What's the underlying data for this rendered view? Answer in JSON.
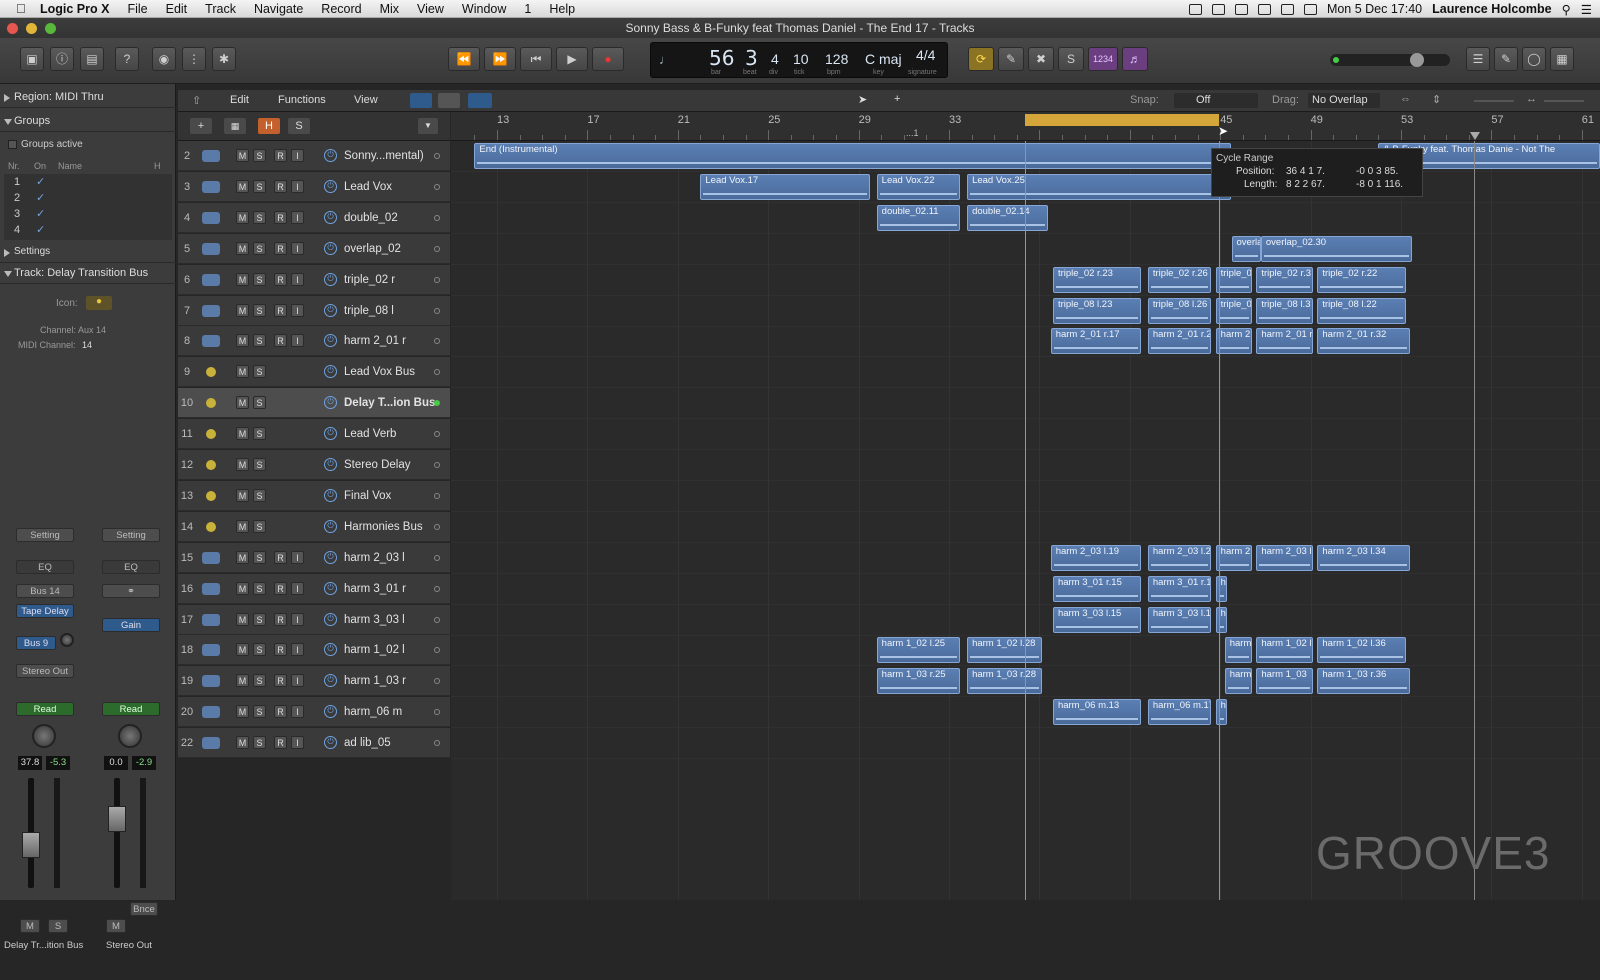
{
  "menubar": {
    "app": "Logic Pro X",
    "items": [
      "File",
      "Edit",
      "Track",
      "Navigate",
      "Record",
      "Mix",
      "View",
      "Window",
      "1",
      "Help"
    ],
    "datetime": "Mon 5 Dec  17:40",
    "user": "Laurence Holcombe"
  },
  "window": {
    "title": "Sonny Bass & B-Funky feat Thomas Daniel - The End 17 - Tracks"
  },
  "lcd": {
    "bar": "56",
    "beat": "3",
    "div": "4",
    "tick": "10",
    "bpm": "128",
    "key": "C maj",
    "sig": "4/4",
    "cap_bar": "bar",
    "cap_beat": "beat",
    "cap_div": "div",
    "cap_tick": "tick",
    "cap_bpm": "bpm",
    "cap_key": "key",
    "cap_sig": "signature"
  },
  "toolbar": {
    "count_in": "1234"
  },
  "subbar": {
    "edit": "Edit",
    "functions": "Functions",
    "view": "View",
    "snap_label": "Snap:",
    "snap_value": "Off",
    "drag_label": "Drag:",
    "drag_value": "No Overlap"
  },
  "inspector": {
    "region": "Region: MIDI Thru",
    "groups": "Groups",
    "groups_active": "Groups active",
    "cols": {
      "nr": "Nr.",
      "on": "On",
      "name": "Name",
      "h": "H"
    },
    "group_rows": [
      "1",
      "2",
      "3",
      "4"
    ],
    "settings": "Settings",
    "track": "Track:  Delay Transition Bus",
    "icon_label": "Icon:",
    "channel": "Channel: Aux 14",
    "midi_channel_label": "MIDI Channel:",
    "midi_channel": "14",
    "strip1": {
      "setting": "Setting",
      "eq": "EQ",
      "bus": "Bus 14",
      "insert": "Tape Delay",
      "send": "Bus 9",
      "output": "Stereo Out",
      "auto": "Read",
      "pan": "37.8",
      "vol": "-5.3",
      "m": "M",
      "s": "S",
      "name": "Delay Tr...ition Bus"
    },
    "strip2": {
      "setting": "Setting",
      "eq": "EQ",
      "insert": "Gain",
      "auto": "Read",
      "pan": "0.0",
      "vol": "-2.9",
      "bnce": "Bnce",
      "m": "M",
      "name": "Stereo Out"
    }
  },
  "ruler": {
    "bars": [
      "13",
      "17",
      "21",
      "25",
      "29",
      "33",
      "37",
      "41",
      "45",
      "49",
      "53",
      "57",
      "61"
    ],
    "marker": "...1"
  },
  "tracks": [
    {
      "num": "2",
      "name": "Sonny...mental)",
      "type": "audio",
      "rs": true
    },
    {
      "num": "3",
      "name": "Lead Vox",
      "type": "audio",
      "rs": true
    },
    {
      "num": "4",
      "name": "double_02",
      "type": "audio",
      "rs": true
    },
    {
      "num": "5",
      "name": "overlap_02",
      "type": "audio",
      "rs": true
    },
    {
      "num": "6",
      "name": "triple_02 r",
      "type": "audio",
      "rs": true
    },
    {
      "num": "7",
      "name": "triple_08 l",
      "type": "audio",
      "rs": true
    },
    {
      "num": "8",
      "name": "harm 2_01 r",
      "type": "audio",
      "rs": true
    },
    {
      "num": "9",
      "name": "Lead Vox Bus",
      "type": "aux",
      "rs": false
    },
    {
      "num": "10",
      "name": "Delay T...ion Bus",
      "type": "aux",
      "rs": false,
      "selected": true
    },
    {
      "num": "11",
      "name": "Lead Verb",
      "type": "aux",
      "rs": false
    },
    {
      "num": "12",
      "name": "Stereo Delay",
      "type": "aux",
      "rs": false
    },
    {
      "num": "13",
      "name": "Final Vox",
      "type": "aux",
      "rs": false
    },
    {
      "num": "14",
      "name": "Harmonies Bus",
      "type": "aux",
      "rs": false
    },
    {
      "num": "15",
      "name": "harm 2_03 l",
      "type": "audio",
      "rs": true
    },
    {
      "num": "16",
      "name": "harm 3_01 r",
      "type": "audio",
      "rs": true
    },
    {
      "num": "17",
      "name": "harm 3_03 l",
      "type": "audio",
      "rs": true
    },
    {
      "num": "18",
      "name": "harm 1_02 l",
      "type": "audio",
      "rs": true
    },
    {
      "num": "19",
      "name": "harm 1_03 r",
      "type": "audio",
      "rs": true
    },
    {
      "num": "20",
      "name": "harm_06 m",
      "type": "audio",
      "rs": true
    },
    {
      "num": "22",
      "name": "ad lib_05",
      "type": "audio",
      "rs": true
    }
  ],
  "track_buttons": {
    "m": "M",
    "s": "S",
    "r": "R",
    "i": "I"
  },
  "regions": [
    {
      "row": 0,
      "bar_start": 12,
      "bar_end": 45.5,
      "label": "End (Instrumental)"
    },
    {
      "row": 0,
      "bar_start": 52,
      "bar_end": 63,
      "label": "& B-Funky feat. Thomas Danie - Not The"
    },
    {
      "row": 1,
      "bar_start": 22,
      "bar_end": 29.5,
      "label": "Lead Vox.17"
    },
    {
      "row": 1,
      "bar_start": 29.8,
      "bar_end": 33.5,
      "label": "Lead Vox.22"
    },
    {
      "row": 1,
      "bar_start": 33.8,
      "bar_end": 45.5,
      "label": "Lead Vox.25"
    },
    {
      "row": 2,
      "bar_start": 29.8,
      "bar_end": 33.5,
      "label": "double_02.11"
    },
    {
      "row": 2,
      "bar_start": 33.8,
      "bar_end": 37.4,
      "label": "double_02.14"
    },
    {
      "row": 3,
      "bar_start": 45.5,
      "bar_end": 46.8,
      "label": "overla"
    },
    {
      "row": 3,
      "bar_start": 46.8,
      "bar_end": 53.5,
      "label": "overlap_02.30"
    },
    {
      "row": 4,
      "bar_start": 37.6,
      "bar_end": 41.5,
      "label": "triple_02 r.23"
    },
    {
      "row": 4,
      "bar_start": 41.8,
      "bar_end": 44.6,
      "label": "triple_02 r.26"
    },
    {
      "row": 4,
      "bar_start": 44.8,
      "bar_end": 46.4,
      "label": "triple_0"
    },
    {
      "row": 4,
      "bar_start": 46.6,
      "bar_end": 49.1,
      "label": "triple_02 r.3"
    },
    {
      "row": 4,
      "bar_start": 49.3,
      "bar_end": 53.2,
      "label": "triple_02 r.22"
    },
    {
      "row": 5,
      "bar_start": 37.6,
      "bar_end": 41.5,
      "label": "triple_08 l.23"
    },
    {
      "row": 5,
      "bar_start": 41.8,
      "bar_end": 44.6,
      "label": "triple_08 l.26"
    },
    {
      "row": 5,
      "bar_start": 44.8,
      "bar_end": 46.4,
      "label": "triple_0"
    },
    {
      "row": 5,
      "bar_start": 46.6,
      "bar_end": 49.1,
      "label": "triple_08 l.3"
    },
    {
      "row": 5,
      "bar_start": 49.3,
      "bar_end": 53.2,
      "label": "triple_08 l.22"
    },
    {
      "row": 6,
      "bar_start": 37.5,
      "bar_end": 41.5,
      "label": "harm 2_01 r.17"
    },
    {
      "row": 6,
      "bar_start": 41.8,
      "bar_end": 44.6,
      "label": "harm 2_01 r.2"
    },
    {
      "row": 6,
      "bar_start": 44.8,
      "bar_end": 46.4,
      "label": "harm 2"
    },
    {
      "row": 6,
      "bar_start": 46.6,
      "bar_end": 49.1,
      "label": "harm 2_01 r."
    },
    {
      "row": 6,
      "bar_start": 49.3,
      "bar_end": 53.4,
      "label": "harm 2_01 r.32"
    },
    {
      "row": 13,
      "bar_start": 37.5,
      "bar_end": 41.5,
      "label": "harm 2_03 l.19"
    },
    {
      "row": 13,
      "bar_start": 41.8,
      "bar_end": 44.6,
      "label": "harm 2_03 l.2"
    },
    {
      "row": 13,
      "bar_start": 44.8,
      "bar_end": 46.4,
      "label": "harm 2"
    },
    {
      "row": 13,
      "bar_start": 46.6,
      "bar_end": 49.1,
      "label": "harm 2_03 l"
    },
    {
      "row": 13,
      "bar_start": 49.3,
      "bar_end": 53.4,
      "label": "harm 2_03 l.34"
    },
    {
      "row": 14,
      "bar_start": 37.6,
      "bar_end": 41.5,
      "label": "harm 3_01 r.15"
    },
    {
      "row": 14,
      "bar_start": 41.8,
      "bar_end": 44.6,
      "label": "harm 3_01 r.19"
    },
    {
      "row": 14,
      "bar_start": 44.8,
      "bar_end": 45.3,
      "label": "ha"
    },
    {
      "row": 15,
      "bar_start": 37.6,
      "bar_end": 41.5,
      "label": "harm 3_03 l.15"
    },
    {
      "row": 15,
      "bar_start": 41.8,
      "bar_end": 44.6,
      "label": "harm 3_03 l.19"
    },
    {
      "row": 15,
      "bar_start": 44.8,
      "bar_end": 45.3,
      "label": "ha"
    },
    {
      "row": 16,
      "bar_start": 29.8,
      "bar_end": 33.5,
      "label": "harm 1_02 l.25"
    },
    {
      "row": 16,
      "bar_start": 33.8,
      "bar_end": 37.1,
      "label": "harm 1_02 l.28"
    },
    {
      "row": 16,
      "bar_start": 45.2,
      "bar_end": 46.4,
      "label": "harm"
    },
    {
      "row": 16,
      "bar_start": 46.6,
      "bar_end": 49.1,
      "label": "harm 1_02 l"
    },
    {
      "row": 16,
      "bar_start": 49.3,
      "bar_end": 53.2,
      "label": "harm 1_02 l.36"
    },
    {
      "row": 17,
      "bar_start": 29.8,
      "bar_end": 33.5,
      "label": "harm 1_03 r.25"
    },
    {
      "row": 17,
      "bar_start": 33.8,
      "bar_end": 37.1,
      "label": "harm 1_03 r.28"
    },
    {
      "row": 17,
      "bar_start": 45.2,
      "bar_end": 46.4,
      "label": "harm"
    },
    {
      "row": 17,
      "bar_start": 46.6,
      "bar_end": 49.1,
      "label": "harm 1_03"
    },
    {
      "row": 17,
      "bar_start": 49.3,
      "bar_end": 53.4,
      "label": "harm 1_03 r.36"
    },
    {
      "row": 18,
      "bar_start": 37.6,
      "bar_end": 41.5,
      "label": "harm_06 m.13"
    },
    {
      "row": 18,
      "bar_start": 41.8,
      "bar_end": 44.6,
      "label": "harm_06 m.17"
    },
    {
      "row": 18,
      "bar_start": 44.8,
      "bar_end": 45.3,
      "label": "ha"
    }
  ],
  "tooltip": {
    "title": "Cycle Range",
    "pos_label": "Position:",
    "pos": "36 4 1 7.",
    "pos2": "-0 0 3 85.",
    "len_label": "Length:",
    "len": "8 2 2 67.",
    "len2": "-8 0 1 116."
  },
  "watermark": "GROOVE3"
}
